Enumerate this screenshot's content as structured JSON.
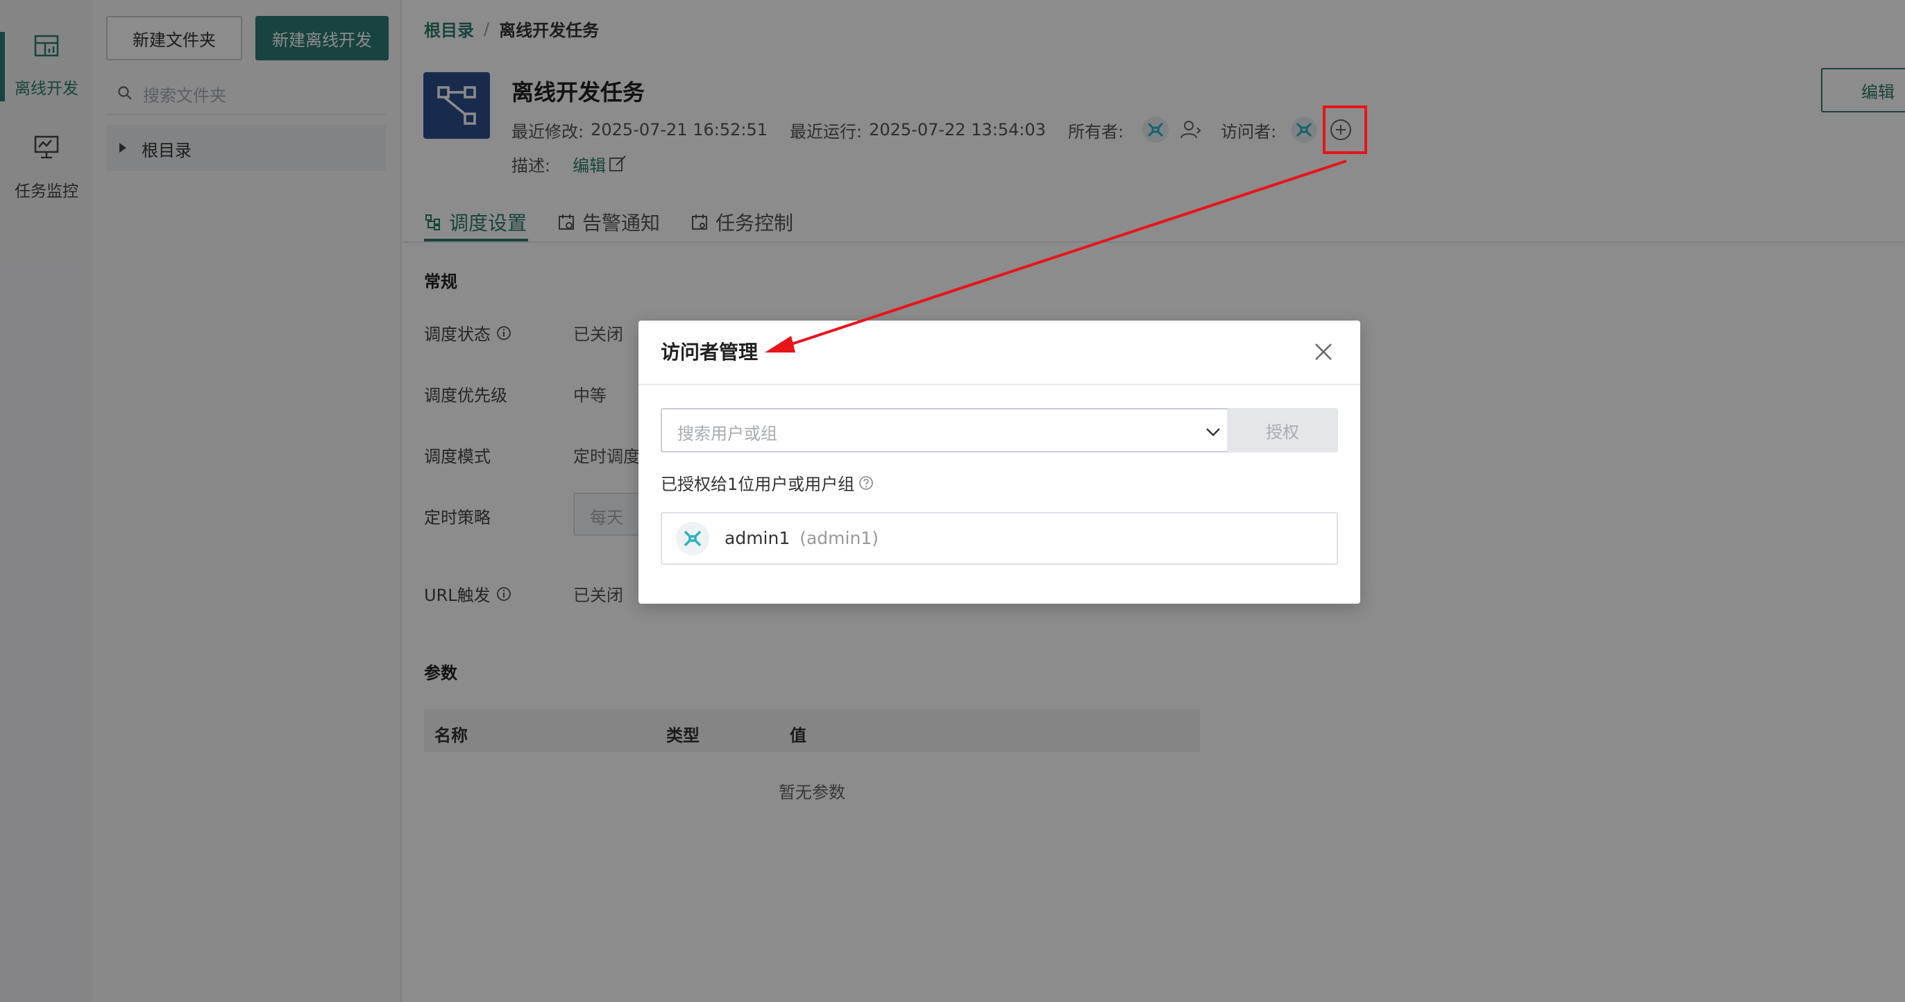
{
  "nav": {
    "items": [
      {
        "label": "离线开发",
        "icon": "offline-dev-icon",
        "active": true
      },
      {
        "label": "任务监控",
        "icon": "task-monitor-icon",
        "active": false
      }
    ]
  },
  "tree": {
    "new_folder": "新建文件夹",
    "new_offline": "新建离线开发",
    "search_placeholder": "搜索文件夹",
    "root": "根目录"
  },
  "breadcrumb": {
    "root": "根目录",
    "sep": "/",
    "current": "离线开发任务"
  },
  "task": {
    "title": "离线开发任务",
    "modified_label": "最近修改:",
    "modified_value": "2025-07-21 16:52:51",
    "run_label": "最近运行:",
    "run_value": "2025-07-22 13:54:03",
    "owner_label": "所有者:",
    "visitor_label": "访问者:",
    "desc_label": "描述:",
    "desc_edit": "编辑",
    "edit_button": "编辑"
  },
  "tabs": [
    {
      "label": "调度设置",
      "active": true
    },
    {
      "label": "告警通知",
      "active": false
    },
    {
      "label": "任务控制",
      "active": false
    }
  ],
  "form": {
    "section_general": "常规",
    "schedule_status_label": "调度状态",
    "schedule_status_value": "已关闭",
    "priority_label": "调度优先级",
    "priority_value": "中等",
    "mode_label": "调度模式",
    "mode_value": "定时调度",
    "strategy_label": "定时策略",
    "strategy_value": "每天",
    "url_label": "URL触发",
    "url_value": "已关闭",
    "section_params": "参数",
    "param_headers": [
      "名称",
      "类型",
      "值"
    ],
    "param_empty": "暂无参数"
  },
  "modal": {
    "title": "访问者管理",
    "search_placeholder": "搜索用户或组",
    "grant_button": "授权",
    "granted_text": "已授权给1位用户或用户组",
    "user_name": "admin1",
    "user_id": "(admin1)"
  },
  "colors": {
    "accent": "#2d7a71",
    "annotation": "#e8141a"
  }
}
